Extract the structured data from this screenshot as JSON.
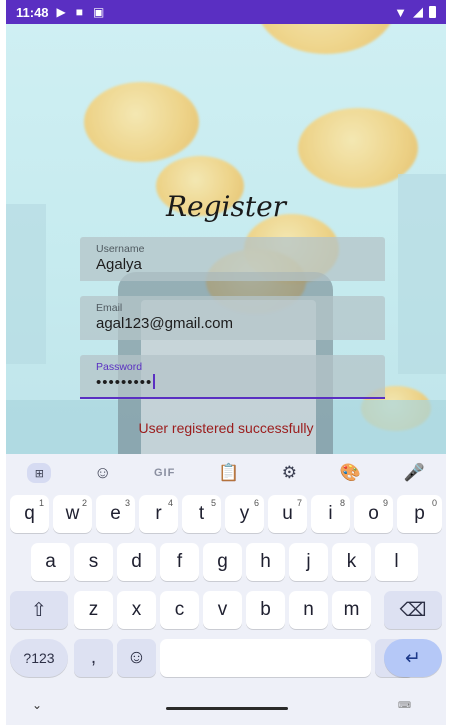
{
  "status_bar": {
    "time": "11:48",
    "icons": [
      "play-icon",
      "photo-icon",
      "square-icon"
    ],
    "right_icons": [
      "wifi-icon",
      "signal-icon",
      "battery-icon"
    ]
  },
  "form": {
    "title": "Register",
    "username": {
      "label": "Username",
      "value": "Agalya"
    },
    "email": {
      "label": "Email",
      "value": "agal123@gmail.com"
    },
    "password": {
      "label": "Password",
      "value": "•••••••••"
    },
    "message": "User registered successfully"
  },
  "keyboard": {
    "toolbar": {
      "grid_icon": "⊞",
      "sticker_icon": "☺",
      "gif_label": "GIF",
      "clipboard_icon": "📋",
      "settings_icon": "⚙",
      "palette_icon": "🎨",
      "mic_icon": "🎤"
    },
    "row1": [
      {
        "k": "q",
        "s": "1"
      },
      {
        "k": "w",
        "s": "2"
      },
      {
        "k": "e",
        "s": "3"
      },
      {
        "k": "r",
        "s": "4"
      },
      {
        "k": "t",
        "s": "5"
      },
      {
        "k": "y",
        "s": "6"
      },
      {
        "k": "u",
        "s": "7"
      },
      {
        "k": "i",
        "s": "8"
      },
      {
        "k": "o",
        "s": "9"
      },
      {
        "k": "p",
        "s": "0"
      }
    ],
    "row2": [
      "a",
      "s",
      "d",
      "f",
      "g",
      "h",
      "j",
      "k",
      "l"
    ],
    "row3": [
      "z",
      "x",
      "c",
      "v",
      "b",
      "n",
      "m"
    ],
    "shift": "⇧",
    "backspace": "⌫",
    "symbols": "?123",
    "comma": ",",
    "emoji": "☺",
    "period": ".",
    "enter": "↵",
    "hide_chevron": "⌄",
    "kb_switch": "⌨"
  },
  "colors": {
    "accent": "#5a2fc2",
    "message": "#9b1c1c"
  }
}
